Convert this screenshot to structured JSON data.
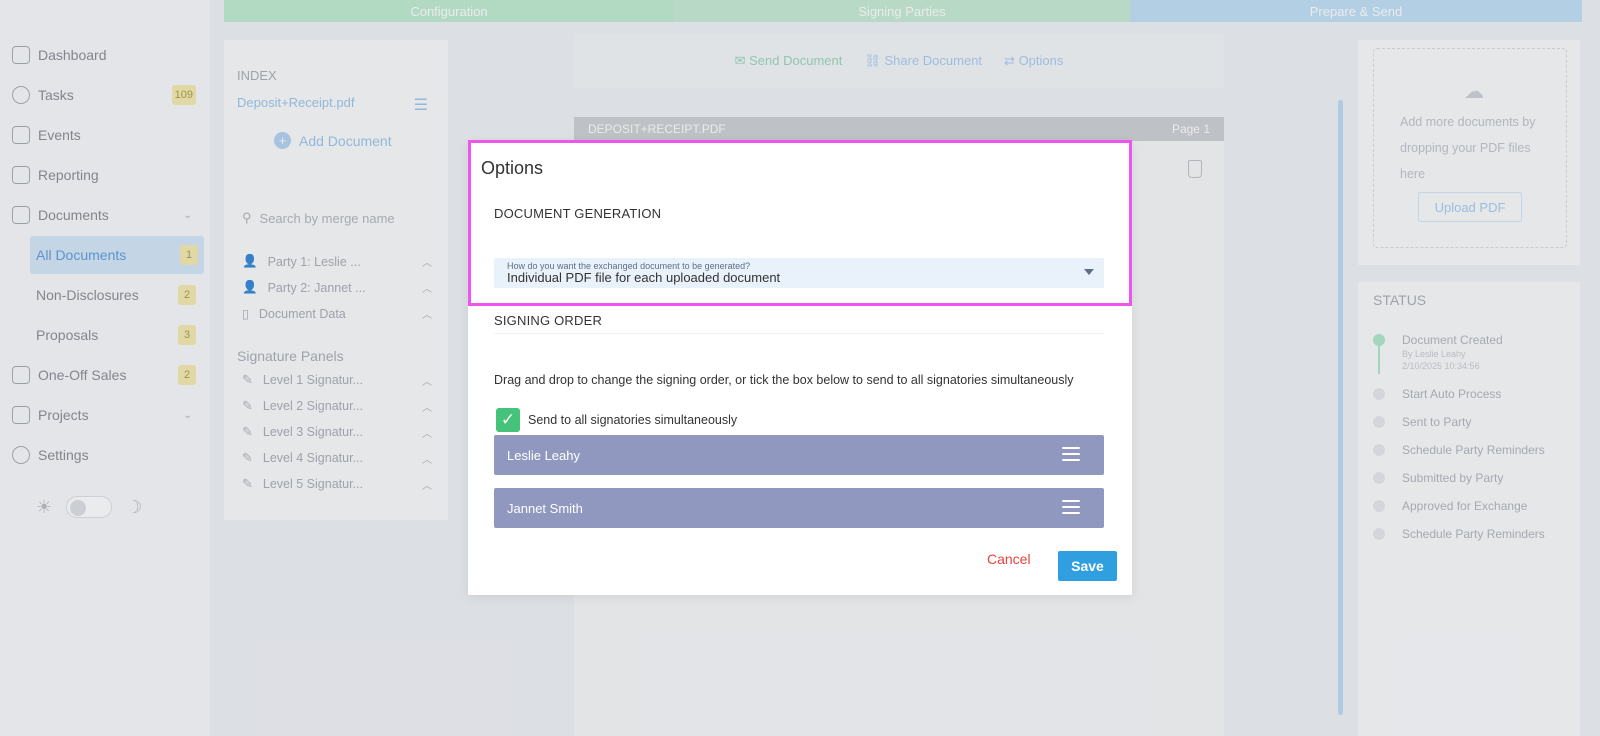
{
  "stepper": {
    "steps": [
      "Configuration",
      "Signing Parties",
      "Prepare & Send"
    ]
  },
  "sidebar": {
    "items": [
      {
        "label": "Dashboard"
      },
      {
        "label": "Tasks",
        "badge": "109"
      },
      {
        "label": "Events"
      },
      {
        "label": "Reporting"
      },
      {
        "label": "Documents"
      },
      {
        "label": "All Documents",
        "badge": "1"
      },
      {
        "label": "Non-Disclosures",
        "badge": "2"
      },
      {
        "label": "Proposals",
        "badge": "3"
      },
      {
        "label": "One-Off Sales",
        "badge": "2"
      },
      {
        "label": "Projects"
      },
      {
        "label": "Settings"
      }
    ],
    "theme_light_icon": "☀",
    "theme_dark_icon": "☽"
  },
  "index": {
    "title": "INDEX",
    "file": "Deposit+Receipt.pdf",
    "add_document": "Add Document",
    "search_placeholder": "Search by merge name",
    "parties": [
      "Party 1: Leslie ...",
      "Party 2: Jannet ...",
      "Document Data"
    ],
    "signature_panels_title": "Signature Panels",
    "levels": [
      "Level 1 Signatur...",
      "Level 2 Signatur...",
      "Level 3 Signatur...",
      "Level 4 Signatur...",
      "Level 5 Signatur..."
    ]
  },
  "doc": {
    "toolbar": {
      "send": "Send Document",
      "share": "Share Document",
      "options": "Options"
    },
    "header_name": "DEPOSIT+RECEIPT.PDF",
    "header_page": "Page 1"
  },
  "right": {
    "dropzone_text": "Add more documents by dropping your PDF files here",
    "upload_button": "Upload PDF",
    "status_title": "STATUS",
    "status_items": [
      "Document Created",
      "Start Auto Process",
      "Sent to Party",
      "Schedule Party Reminders",
      "Submitted by Party",
      "Approved for Exchange",
      "Schedule Party Reminders"
    ],
    "status_created_by": "By Leslie Leahy",
    "status_created_at": "2/10/2025 10:34:56"
  },
  "modal": {
    "title": "Options",
    "doc_generation_title": "DOCUMENT GENERATION",
    "select_label": "How do you want the exchanged document to be generated?",
    "select_value": "Individual PDF file for each uploaded document",
    "signing_order_title": "SIGNING ORDER",
    "description": "Drag and drop to change the signing order, or tick the box below to send to all signatories simultaneously",
    "checkbox_label": "Send to all signatories simultaneously",
    "checkbox_checked": true,
    "signers": [
      "Leslie Leahy",
      "Jannet Smith"
    ],
    "cancel": "Cancel",
    "save": "Save"
  },
  "colors": {
    "accent": "#2f9fe0",
    "cancel": "#e5433b",
    "signer_bar": "#9098bf",
    "checkbox": "#45c37a",
    "highlight": "#ee55ee"
  }
}
